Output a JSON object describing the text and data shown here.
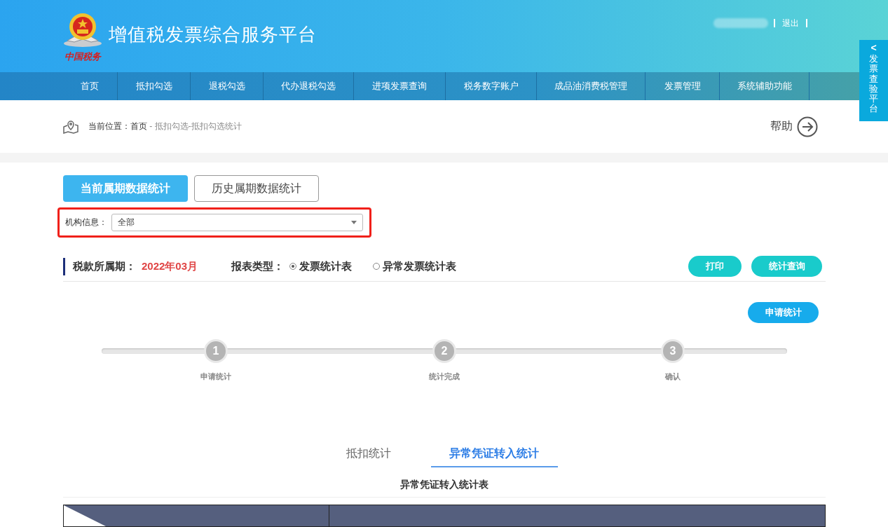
{
  "header": {
    "emblem_text": "中国税务",
    "title": "增值税发票综合服务平台",
    "logout": "退出"
  },
  "side_tab": {
    "arrow": "<",
    "label": "发票查验平台"
  },
  "nav": [
    {
      "label": "首页"
    },
    {
      "label": "抵扣勾选"
    },
    {
      "label": "退税勾选"
    },
    {
      "label": "代办退税勾选"
    },
    {
      "label": "进项发票查询"
    },
    {
      "label": "税务数字账户"
    },
    {
      "label": "成品油消费税管理"
    },
    {
      "label": "发票管理"
    },
    {
      "label": "系统辅助功能"
    }
  ],
  "breadcrumb": {
    "prefix": "当前位置：",
    "home": "首页",
    "path": " - 抵扣勾选-抵扣勾选统计",
    "help": "帮助"
  },
  "period_tabs": [
    {
      "label": "当前属期数据统计",
      "selected": true
    },
    {
      "label": "历史属期数据统计",
      "selected": false
    }
  ],
  "org_filter": {
    "label": "机构信息：",
    "value": "全部",
    "highlighted": true
  },
  "period": {
    "label": "税款所属期：",
    "value": "2022年03月"
  },
  "report_type": {
    "label": "报表类型：",
    "options": [
      {
        "label": "发票统计表",
        "selected": true
      },
      {
        "label": "异常发票统计表",
        "selected": false
      }
    ]
  },
  "actions": [
    "打印",
    "统计查询"
  ],
  "apply_button": "申请统计",
  "steps": [
    {
      "number": "1",
      "label": "申请统计"
    },
    {
      "number": "2",
      "label": "统计完成"
    },
    {
      "number": "3",
      "label": "确认"
    }
  ],
  "bottom_tabs": [
    {
      "label": "抵扣统计",
      "selected": false
    },
    {
      "label": "异常凭证转入统计",
      "selected": true
    }
  ],
  "table_title": "异常凭证转入统计表"
}
